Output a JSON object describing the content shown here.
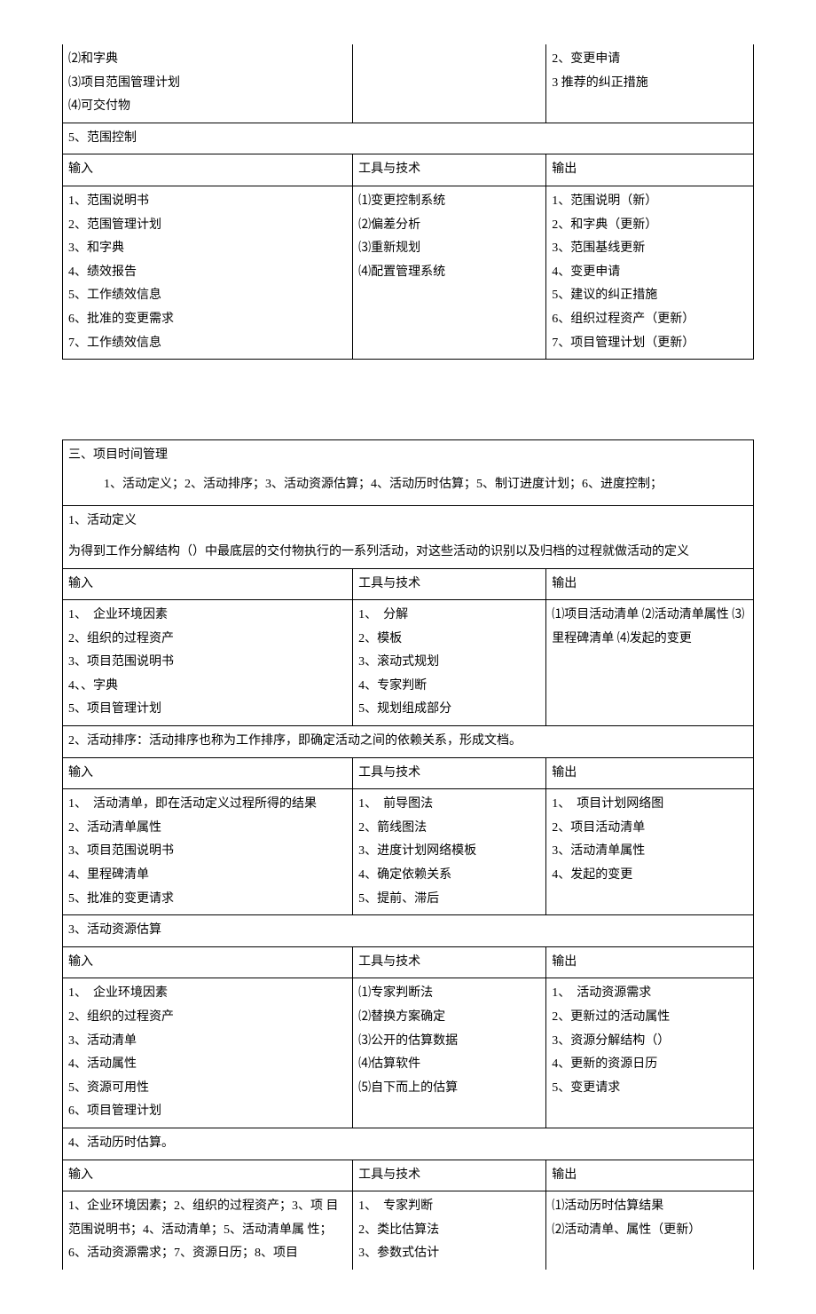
{
  "top_block": {
    "col1": [
      "⑵和字典",
      "⑶项目范围管理计划",
      "⑷可交付物"
    ],
    "col3": [
      "2、变更申请",
      "3 推荐的纠正措施"
    ]
  },
  "section5": {
    "title": "5、范围控制",
    "header": {
      "c1": "输入",
      "c2": "工具与技术",
      "c3": "输出"
    },
    "c1": [
      "1、范围说明书",
      "2、范围管理计划",
      "3、和字典",
      "4、绩效报告",
      "5、工作绩效信息",
      "6、批准的变更需求",
      "7、工作绩效信息"
    ],
    "c2": [
      "⑴变更控制系统",
      "⑵偏差分析",
      "⑶重新规划",
      "⑷配置管理系统"
    ],
    "c3": [
      "1、范围说明（新）",
      "2、和字典（更新）",
      "3、范围基线更新",
      "4、变更申请",
      "5、建议的纠正措施",
      "6、组织过程资产（更新）",
      "7、项目管理计划（更新）"
    ]
  },
  "time_mgmt": {
    "title": "三、项目时间管理",
    "overview_indent": "1、活动定义；2、活动排序；3、活动资源估算；4、活动历时估算；5、制订进度计划；6、进度控制；",
    "s1": {
      "title": "1、活动定义",
      "desc": "为得到工作分解结构（）中最底层的交付物执行的一系列活动，对这些活动的识别以及归档的过程就做活动的定义",
      "header": {
        "c1": "输入",
        "c2": "工具与技术",
        "c3": "输出"
      },
      "c1": [
        "1、　企业环境因素",
        "2、组织的过程资产",
        "3、项目范围说明书",
        "4、、字典",
        "5、项目管理计划"
      ],
      "c2": [
        "1、　分解",
        "2、模板",
        "3、滚动式规划",
        "4、专家判断",
        "5、规划组成部分"
      ],
      "c3": "⑴项目活动清单 ⑵活动清单属性 ⑶里程碑清单 ⑷发起的变更"
    },
    "s2": {
      "title": "2、活动排序：活动排序也称为工作排序，即确定活动之间的依赖关系，形成文档。",
      "header": {
        "c1": "输入",
        "c2": "工具与技术",
        "c3": "输出"
      },
      "c1": [
        "1、　活动清单，即在活动定义过程所得的结果",
        "2、活动清单属性",
        "3、项目范围说明书",
        "4、里程碑清单",
        "5、批准的变更请求"
      ],
      "c2": [
        "1、　前导图法",
        "2、箭线图法",
        "3、进度计划网络模板",
        "4、确定依赖关系",
        "5、提前、滞后"
      ],
      "c3": [
        "1、　项目计划网络图",
        "2、项目活动清单",
        "3、活动清单属性",
        "4、发起的变更"
      ]
    },
    "s3": {
      "title": "3、活动资源估算",
      "header": {
        "c1": "输入",
        "c2": "工具与技术",
        "c3": "输出"
      },
      "c1": [
        "1、　企业环境因素",
        "2、组织的过程资产",
        "3、活动清单",
        "4、活动属性",
        "5、资源可用性",
        "6、项目管理计划"
      ],
      "c2": [
        "⑴专家判断法",
        "⑵替换方案确定",
        "⑶公开的估算数据",
        "⑷估算软件",
        "⑸自下而上的估算"
      ],
      "c3": [
        "1、　活动资源需求",
        "2、更新过的活动属性",
        "3、资源分解结构（）",
        "4、更新的资源日历",
        "5、变更请求"
      ]
    },
    "s4": {
      "title": "4、活动历时估算。",
      "header": {
        "c1": "输入",
        "c2": "工具与技术",
        "c3": "输出"
      },
      "c1": "1、企业环境因素；2、组织的过程资产；3、项 目范围说明书；4、活动清单；5、活动清单属 性；6、活动资源需求；7、资源日历；8、项目",
      "c2": [
        "1、　专家判断",
        "2、类比估算法",
        "3、参数式估计"
      ],
      "c3": [
        "⑴活动历时估算结果",
        "⑵活动清单、属性（更新）"
      ]
    }
  }
}
